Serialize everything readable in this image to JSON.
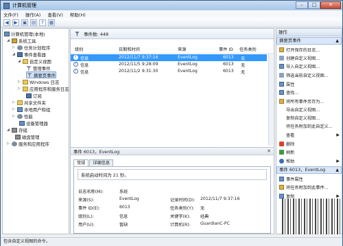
{
  "window": {
    "title": "计算机管理"
  },
  "menu": [
    "文件(F)",
    "操作(A)",
    "查看(V)",
    "帮助(H)"
  ],
  "tree": {
    "root": "计算机管理(本地)",
    "sys_tools": "系统工具",
    "task_sched": "任务计划程序",
    "event_viewer": "事件查看器",
    "custom_views": "自定义视图",
    "admin_events": "管理事件",
    "summary_events": "摘要页事件",
    "windows_logs": "Windows 日志",
    "app_logs": "应用程序和服务日志",
    "subscriptions": "订阅",
    "shared_folders": "共享文件夹",
    "local_users": "本地用户和组",
    "performance": "性能",
    "device_mgr": "设备管理器",
    "storage": "存储",
    "disk_mgmt": "磁盘管理",
    "services_apps": "服务和应用程序"
  },
  "events": {
    "header": "事件数: 448",
    "columns": [
      "级别",
      "日期和时间",
      "来源",
      "事件 ID",
      "任务类别"
    ],
    "rows": [
      {
        "level": "信息",
        "datetime": "2012/11/7 9:37:16",
        "source": "EventLog",
        "id": "6013",
        "category": "无"
      },
      {
        "level": "信息",
        "datetime": "2012/11/5 9:28:09",
        "source": "EventLog",
        "id": "6013",
        "category": "无"
      },
      {
        "level": "信息",
        "datetime": "2012/11/2 9:31:30",
        "source": "EventLog",
        "id": "6013",
        "category": "无"
      }
    ]
  },
  "detail": {
    "title": "事件 6013，EventLog",
    "tabs": [
      "常规",
      "详细信息"
    ],
    "message": "系统启动时间为 21 秒。",
    "fields": {
      "logname_label": "日志名称(M):",
      "logname": "系统",
      "source_label": "来源(S):",
      "source": "EventLog",
      "logged_label": "记录时间(D):",
      "logged": "2012/11/7 9:37:16",
      "eventid_label": "事件 ID(E):",
      "eventid": "6013",
      "taskcat_label": "任务类别(Y):",
      "taskcat": "无",
      "level_label": "级别(L):",
      "level": "信息",
      "keywords_label": "关键字(K):",
      "keywords": "经典",
      "user_label": "用户(U):",
      "user": "暂缺",
      "computer_label": "计算机(R):",
      "computer": "GuardianC-PC"
    }
  },
  "actions": {
    "header": "操作",
    "section1": "摘要页事件",
    "items1": [
      "打开保存的日志...",
      "创建自定义视图...",
      "导入自定义视图...",
      "筛选当前自定义视图...",
      "属性",
      "查找...",
      "将所有事件另存为...",
      "导出自定义视图...",
      "复制自定义视图...",
      "将任务附加到此自定义...",
      "查看",
      "删除",
      "刷新",
      "帮助"
    ],
    "section2": "事件 6013，EventLog",
    "items2": [
      "事件属性",
      "将任务附加到此事件...",
      "复制"
    ]
  },
  "status": "包含自定义视图的命令。"
}
